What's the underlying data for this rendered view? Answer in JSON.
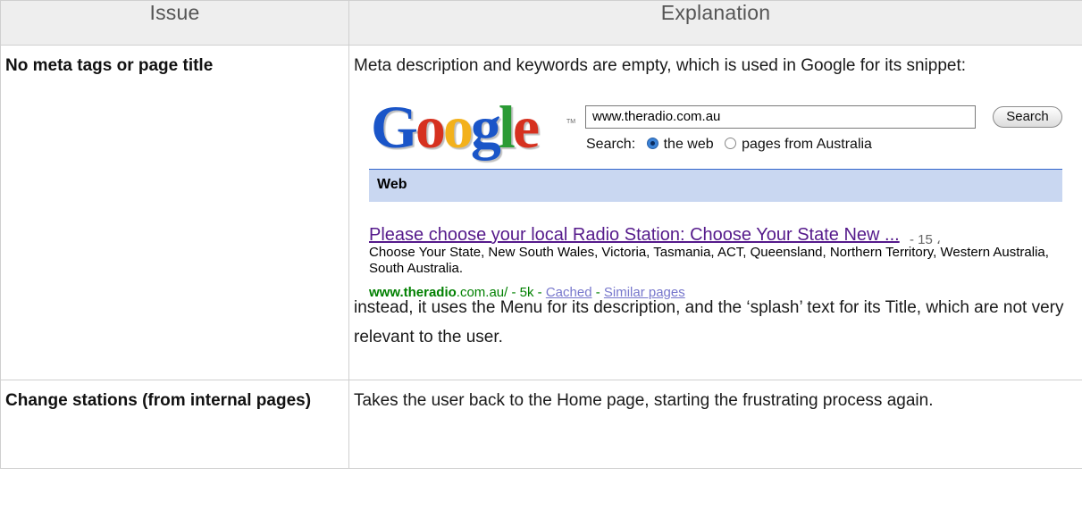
{
  "table": {
    "headers": {
      "issue": "Issue",
      "explanation": "Explanation"
    },
    "rows": [
      {
        "issue": "No meta tags or page title",
        "explanation_intro": "Meta description and keywords are empty, which is used in Google for its snippet:",
        "explanation_outro": "instead, it uses the Menu for its description, and the ‘splash’ text for its Title, which are not very relevant to the user."
      },
      {
        "issue": "Change stations (from internal pages)",
        "explanation": "Takes the user back to the Home page, starting the frustrating process again."
      }
    ]
  },
  "google_snippet": {
    "logo_letters": [
      "G",
      "o",
      "o",
      "g",
      "l",
      "e"
    ],
    "logo_colors": [
      "#1a55c8",
      "#d6311f",
      "#f3b11b",
      "#1a55c8",
      "#2b9b35",
      "#d6311f"
    ],
    "trademark": "TM",
    "search_value": "www.theradio.com.au",
    "search_button": "Search",
    "search_label": "Search:",
    "option_web": "the web",
    "option_australia": "pages from Australia",
    "bar_label": "Web",
    "result_title": "Please choose your local Radio Station: Choose Your State New ...",
    "result_meta": "- 15 ،",
    "result_desc": "Choose Your State, New South Wales, Victoria, Tasmania, ACT, Queensland, Northern Territory, Western Australia, South Australia.",
    "result_url_bold": "www.theradio",
    "result_url_rest": ".com.au/ - 5k - ",
    "cached": "Cached",
    "dash": " - ",
    "similar": "Similar pages"
  }
}
